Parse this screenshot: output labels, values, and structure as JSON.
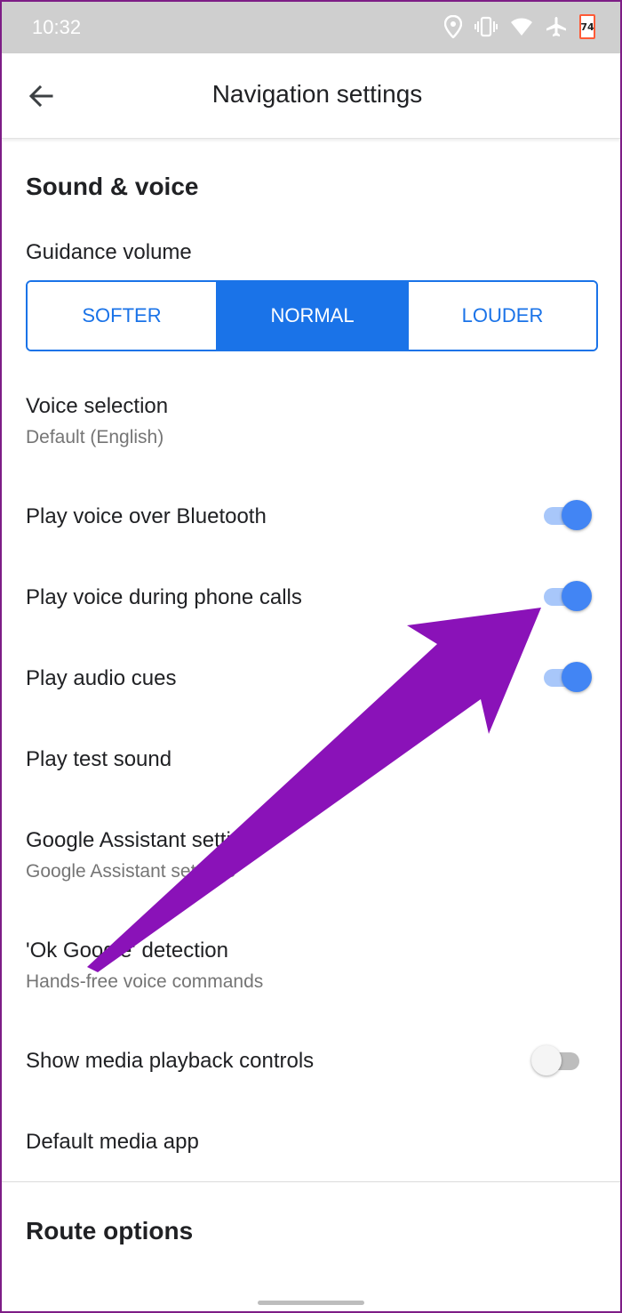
{
  "status_bar": {
    "time": "10:32",
    "battery_level": "74",
    "icons": [
      "location-icon",
      "vibrate-icon",
      "wifi-icon",
      "airplane-icon",
      "battery-icon"
    ]
  },
  "app_bar": {
    "title": "Navigation settings",
    "back_icon": "arrow-back-icon"
  },
  "sound_voice": {
    "section_title": "Sound & voice",
    "guidance_volume": {
      "label": "Guidance volume",
      "options": [
        "SOFTER",
        "NORMAL",
        "LOUDER"
      ],
      "selected": "NORMAL"
    },
    "voice_selection": {
      "label": "Voice selection",
      "value": "Default (English)"
    },
    "bluetooth": {
      "label": "Play voice over Bluetooth",
      "on": true
    },
    "phone_calls": {
      "label": "Play voice during phone calls",
      "on": true
    },
    "audio_cues": {
      "label": "Play audio cues",
      "on": true
    },
    "test_sound": {
      "label": "Play test sound"
    },
    "assistant": {
      "label": "Google Assistant settings",
      "sublabel": "Google Assistant settings"
    },
    "ok_google": {
      "label": "'Ok Google' detection",
      "sublabel": "Hands-free voice commands"
    },
    "media_controls": {
      "label": "Show media playback controls",
      "on": false
    },
    "media_app": {
      "label": "Default media app"
    }
  },
  "route_options": {
    "section_title": "Route options"
  },
  "colors": {
    "accent": "#1a73e8",
    "toggle_on": "#4285f4",
    "annotation_arrow": "#8a12b8",
    "frame_border": "#7d1d86"
  },
  "annotation": {
    "icon": "pointer-arrow-icon"
  }
}
